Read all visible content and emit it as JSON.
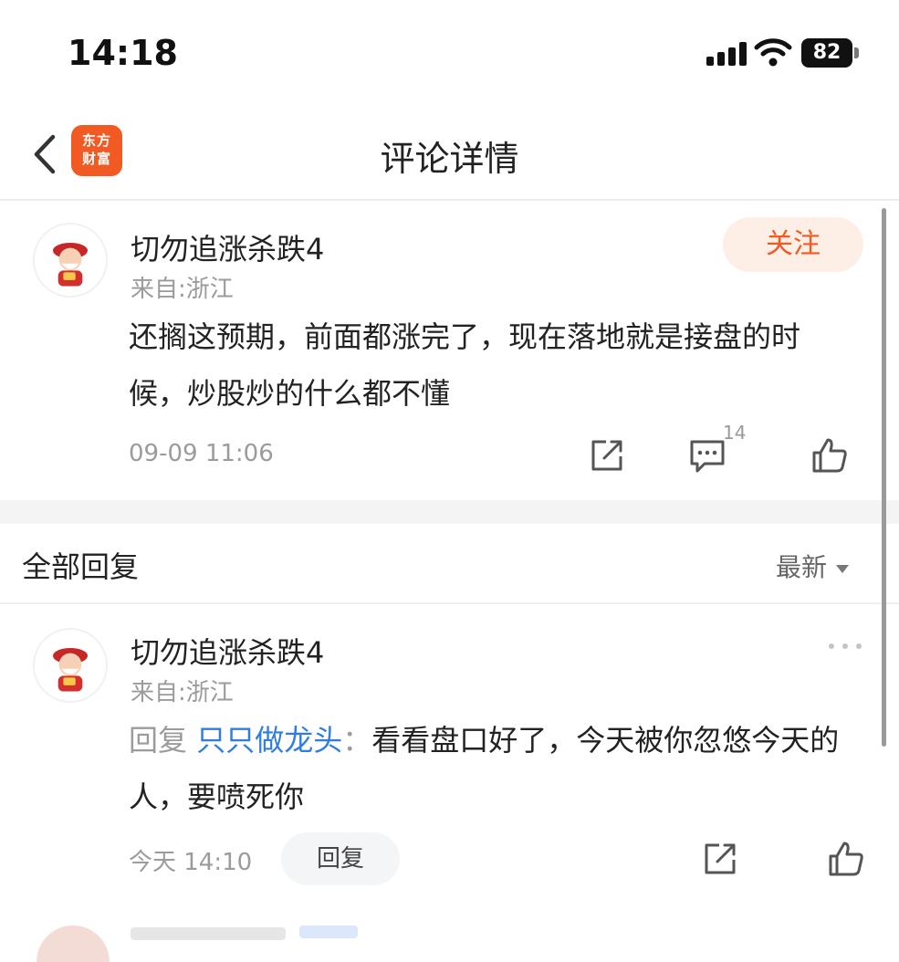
{
  "status_bar": {
    "time": "14:18",
    "battery": "82"
  },
  "nav": {
    "title": "评论详情",
    "logo_line1": "东方",
    "logo_line2": "财富"
  },
  "main_comment": {
    "username": "切勿追涨杀跌4",
    "location": "来自:浙江",
    "follow_label": "关注",
    "text": "还搁这预期，前面都涨完了，现在落地就是接盘的时候，炒股炒的什么都不懂",
    "timestamp": "09-09 11:06",
    "reply_count": "14"
  },
  "replies_section": {
    "title": "全部回复",
    "sort_label": "最新"
  },
  "replies": [
    {
      "username": "切勿追涨杀跌4",
      "location": "来自:浙江",
      "reply_prefix": "回复",
      "reply_to": "只只做龙头",
      "colon": "：",
      "text": "看看盘口好了，今天被你忽悠今天的人，要喷死你",
      "timestamp": "今天 14:10",
      "reply_button": "回复"
    }
  ],
  "colors": {
    "accent": "#f15a22",
    "link": "#2f7de1",
    "muted": "#9b9b9b"
  },
  "icons": [
    "chevron-left-icon",
    "share-icon",
    "comment-icon",
    "thumbs-up-icon",
    "more-icon",
    "signal-icon",
    "wifi-icon",
    "battery-icon"
  ]
}
